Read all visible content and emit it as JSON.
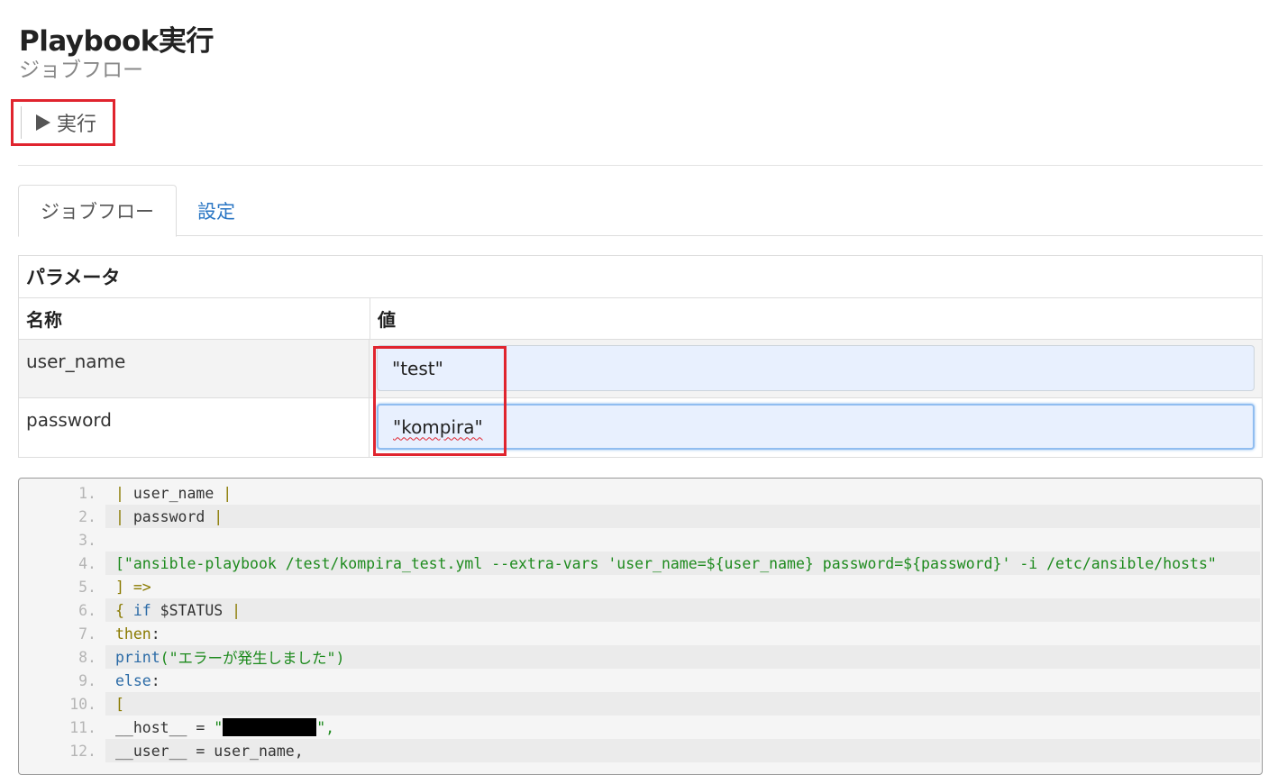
{
  "header": {
    "title": "Playbook実行",
    "subtitle": "ジョブフロー"
  },
  "toolbar": {
    "run_label": "実行"
  },
  "tabs": [
    {
      "label": "ジョブフロー",
      "active": true
    },
    {
      "label": "設定",
      "active": false
    }
  ],
  "params": {
    "title": "パラメータ",
    "col_name": "名称",
    "col_value": "値",
    "rows": [
      {
        "name": "user_name",
        "value": "\"test\""
      },
      {
        "name": "password",
        "value": "\"kompira\""
      }
    ]
  },
  "code": {
    "line_numbers": [
      "1.",
      "2.",
      "3.",
      "4.",
      "5.",
      "6.",
      "7.",
      "8.",
      "9.",
      "10.",
      "11.",
      "12."
    ],
    "l1": [
      "| ",
      "user_name",
      " |"
    ],
    "l2": [
      "| ",
      "password",
      " |"
    ],
    "l4": "[\"ansible-playbook /test/kompira_test.yml --extra-vars 'user_name=${user_name} password=${password}' -i /etc/ansible/hosts\"",
    "l5": "] =>",
    "l6": [
      "{ ",
      "if",
      " $STATUS ",
      "|"
    ],
    "l7": [
      "then",
      ":"
    ],
    "l8": [
      "print",
      "(\"エラーが発生しました\")"
    ],
    "l9": [
      "else",
      ":"
    ],
    "l10": "[",
    "l11": [
      "__host__ = ",
      "\"",
      "\","
    ],
    "l12": [
      "__user__ = ",
      "user_name",
      ","
    ]
  },
  "colors": {
    "highlight": "#e0242e",
    "link": "#2a76c4",
    "input_bg": "#e8f0fe"
  }
}
